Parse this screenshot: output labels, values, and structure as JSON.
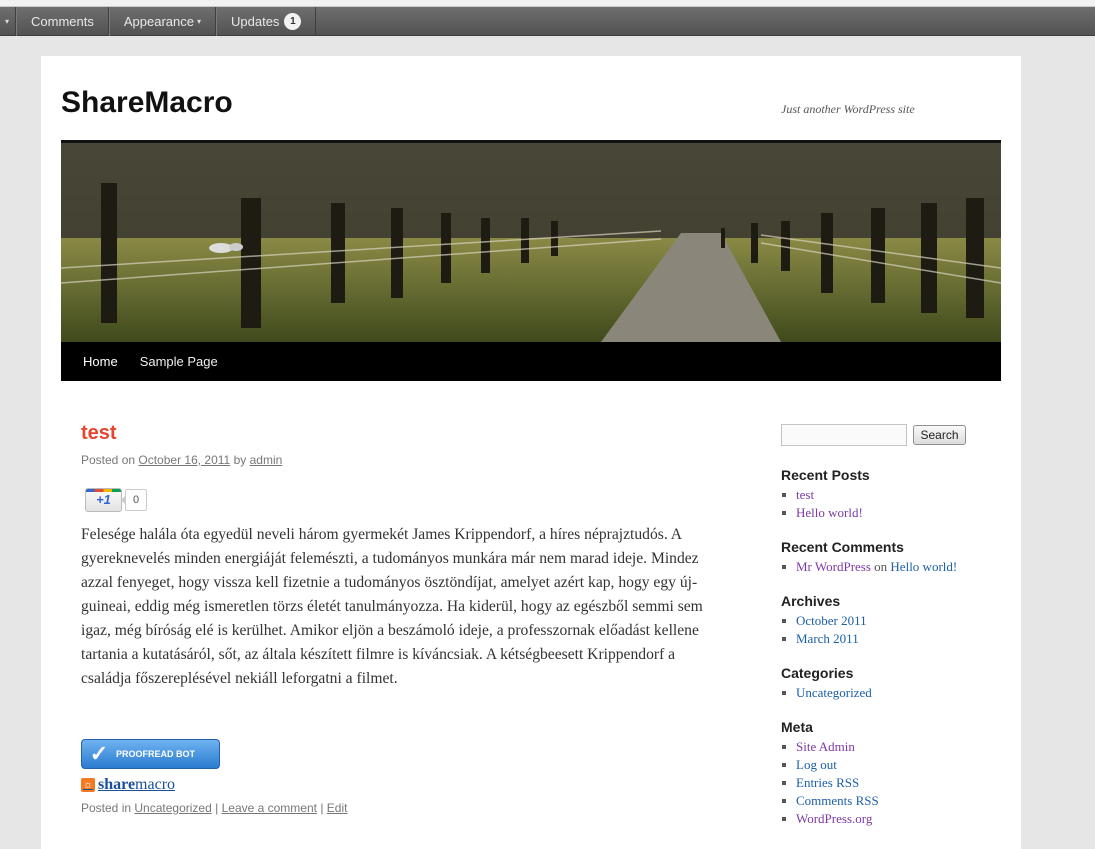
{
  "admin_bar": {
    "items": [
      {
        "label": "",
        "caret": "▾"
      },
      {
        "label": "Comments"
      },
      {
        "label": "Appearance",
        "caret": "▾"
      },
      {
        "label": "Updates",
        "count": "1"
      }
    ]
  },
  "site": {
    "title": "ShareMacro",
    "description": "Just another WordPress site"
  },
  "nav": {
    "items": [
      "Home",
      "Sample Page"
    ]
  },
  "post": {
    "title": "test",
    "posted_on": "Posted on",
    "date": "October 16, 2011",
    "by": "by",
    "author": "admin",
    "plusone_label": "+1",
    "plusone_count": "0",
    "body": "Felesége halála óta egyedül neveli három gyermekét James Krippendorf, a híres néprajztudós. A gyereknevelés minden energiáját felemészti, a tudományos munkára már nem marad ideje. Mindez azzal fenyeget, hogy vissza kell fizetnie a tudományos ösztöndíjat, amelyet azért kap, hogy egy új-guineai, eddig még ismeretlen törzs életét tanulmányozza. Ha kiderül, hogy az egészből semmi sem igaz, még bíróság elé is kerülhet. Amikor eljön a beszámoló ideje, a professzornak előadást kellene tartania a kutatásáról, sőt, az általa készített filmre is kíváncsiak. A kétségbeesett Krippendorf a családja főszereplésével nekiáll leforgatni a filmet.",
    "proofread_label": "PROOFREAD BOT",
    "share_bold": "share",
    "share_rest": "macro",
    "posted_in": "Posted in",
    "category": "Uncategorized",
    "sep": "|",
    "leave_comment": "Leave a comment",
    "edit": "Edit"
  },
  "sidebar": {
    "search_button": "Search",
    "recent_posts": {
      "title": "Recent Posts",
      "items": [
        "test",
        "Hello world!"
      ]
    },
    "recent_comments": {
      "title": "Recent Comments",
      "author": "Mr WordPress",
      "on": "on",
      "post": "Hello world!"
    },
    "archives": {
      "title": "Archives",
      "items": [
        "October 2011",
        "March 2011"
      ]
    },
    "categories": {
      "title": "Categories",
      "items": [
        "Uncategorized"
      ]
    },
    "meta": {
      "title": "Meta",
      "items": [
        "Site Admin",
        "Log out",
        "Entries RSS",
        "Comments RSS",
        "WordPress.org"
      ]
    }
  },
  "colors": {
    "post_title": "#e8452f",
    "link": "#1b5fa8",
    "visited_link": "#7d3aa3",
    "nav_bg": "#000000"
  }
}
